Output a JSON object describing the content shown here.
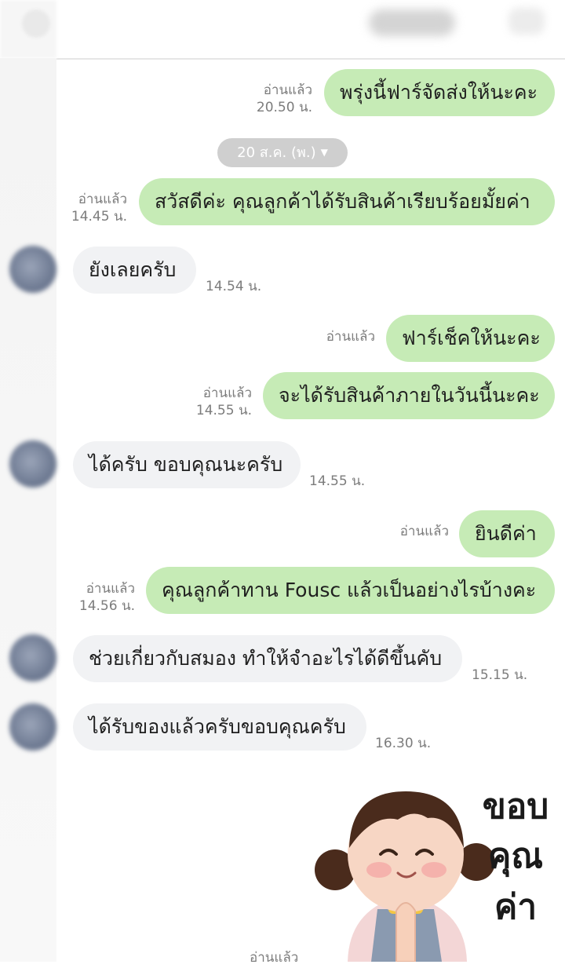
{
  "header": {
    "title": "",
    "back_icon": "back-arrow-icon",
    "menu_icon": "menu-icon"
  },
  "date_divider": {
    "label": "20 ส.ค. (พ.)"
  },
  "messages": [
    {
      "side": "out",
      "text": "พรุ่งนี้ฟาร์จัดส่งให้นะคะ",
      "read": "อ่านแล้ว",
      "time": "20.50 น."
    },
    {
      "side": "out",
      "text": "สวัสดีค่ะ คุณลูกค้าได้รับสินค้าเรียบร้อยมั้ยค่า",
      "read": "อ่านแล้ว",
      "time": "14.45 น."
    },
    {
      "side": "in",
      "text": "ยังเลยครับ",
      "time": "14.54 น."
    },
    {
      "side": "out",
      "text": "ฟาร์เช็คให้นะคะ",
      "read": "อ่านแล้ว",
      "time": ""
    },
    {
      "side": "out",
      "text": "จะได้รับสินค้าภายในวันนี้นะคะ",
      "read": "อ่านแล้ว",
      "time": "14.55 น."
    },
    {
      "side": "in",
      "text": "ได้ครับ ขอบคุณนะครับ",
      "time": "14.55 น."
    },
    {
      "side": "out",
      "text": "ยินดีค่า",
      "read": "อ่านแล้ว",
      "time": ""
    },
    {
      "side": "out",
      "text": "คุณลูกค้าทาน Fousc แล้วเป็นอย่างไรบ้างคะ",
      "read": "อ่านแล้ว",
      "time": "14.56 น."
    },
    {
      "side": "in",
      "text": "ช่วยเกี่ยวกับสมอง ทำให้จำอะไรได้ดีขึ้นคับ",
      "time": "15.15 น."
    },
    {
      "side": "in",
      "text": "ได้รับของแล้วครับขอบคุณครับ",
      "time": "16.30 น."
    }
  ],
  "sticker": {
    "caption_line1": "ขอบ",
    "caption_line2": "คุณ",
    "caption_line3": "ค่า"
  },
  "footer": {
    "read": "อ่านแล้ว"
  }
}
